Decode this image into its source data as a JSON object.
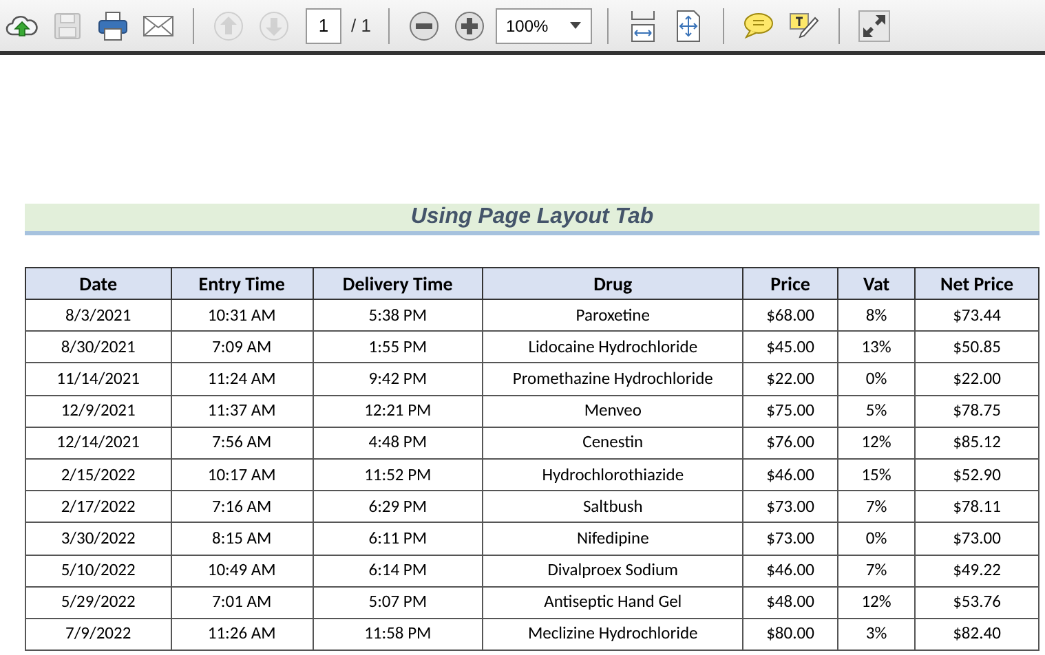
{
  "toolbar": {
    "groups": [
      [
        {
          "kind": "cloud-upload",
          "disabled": false
        },
        {
          "kind": "save",
          "disabled": true
        },
        {
          "kind": "print",
          "disabled": false
        },
        {
          "kind": "mail",
          "disabled": false
        }
      ],
      [
        {
          "kind": "up",
          "disabled": true
        },
        {
          "kind": "down",
          "disabled": true
        }
      ],
      [
        {
          "kind": "minus",
          "disabled": false
        },
        {
          "kind": "plus",
          "disabled": false
        }
      ],
      [
        {
          "kind": "fit-width",
          "disabled": false
        },
        {
          "kind": "fit-page",
          "disabled": false
        }
      ],
      [
        {
          "kind": "comment",
          "disabled": false
        },
        {
          "kind": "highlight",
          "disabled": false
        }
      ],
      [
        {
          "kind": "expand",
          "disabled": false
        }
      ]
    ],
    "page": {
      "value": "1",
      "total": "/ 1"
    },
    "zoom": {
      "value": "100%"
    }
  },
  "title": "Using Page Layout Tab",
  "table": {
    "columns": [
      "Date",
      "Entry Time",
      "Delivery Time",
      "Drug",
      "Price",
      "Vat",
      "Net Price"
    ],
    "rows": [
      [
        "8/3/2021",
        "10:31 AM",
        "5:38 PM",
        "Paroxetine",
        "$68.00",
        "8%",
        "$73.44"
      ],
      [
        "8/30/2021",
        "7:09 AM",
        "1:55 PM",
        "Lidocaine Hydrochloride",
        "$45.00",
        "13%",
        "$50.85"
      ],
      [
        "11/14/2021",
        "11:24 AM",
        "9:42 PM",
        "Promethazine Hydrochloride",
        "$22.00",
        "0%",
        "$22.00"
      ],
      [
        "12/9/2021",
        "11:37 AM",
        "12:21 PM",
        "Menveo",
        "$75.00",
        "5%",
        "$78.75"
      ],
      [
        "12/14/2021",
        "7:56 AM",
        "4:48 PM",
        "Cenestin",
        "$76.00",
        "12%",
        "$85.12"
      ],
      [
        "2/15/2022",
        "10:17 AM",
        "11:52 PM",
        "Hydrochlorothiazide",
        "$46.00",
        "15%",
        "$52.90"
      ],
      [
        "2/17/2022",
        "7:16 AM",
        "6:29 PM",
        "Saltbush",
        "$73.00",
        "7%",
        "$78.11"
      ],
      [
        "3/30/2022",
        "8:15 AM",
        "6:11 PM",
        "Nifedipine",
        "$73.00",
        "0%",
        "$73.00"
      ],
      [
        "5/10/2022",
        "10:49 AM",
        "6:14 PM",
        "Divalproex Sodium",
        "$46.00",
        "7%",
        "$49.22"
      ],
      [
        "5/29/2022",
        "7:01 AM",
        "5:07 PM",
        "Antiseptic Hand Gel",
        "$48.00",
        "12%",
        "$53.76"
      ],
      [
        "7/9/2022",
        "11:26 AM",
        "11:58 PM",
        "Meclizine Hydrochloride",
        "$80.00",
        "3%",
        "$82.40"
      ]
    ]
  }
}
